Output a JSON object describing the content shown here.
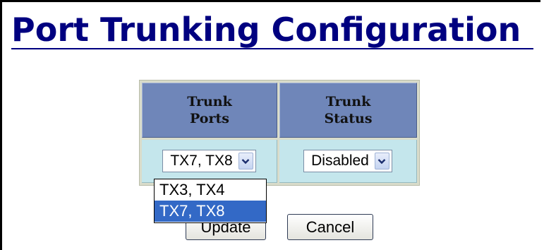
{
  "page": {
    "title": "Port Trunking Configuration"
  },
  "table": {
    "headers": [
      {
        "line1": "Trunk",
        "line2": "Ports"
      },
      {
        "line1": "Trunk",
        "line2": "Status"
      }
    ],
    "row": {
      "trunk_ports_value": "TX7, TX8",
      "trunk_status_value": "Disabled"
    }
  },
  "dropdown": {
    "options": [
      "TX3, TX4",
      "TX7, TX8"
    ],
    "highlighted_index": 1
  },
  "buttons": {
    "update_label": "Update",
    "cancel_label": "Cancel"
  },
  "icons": {
    "dropdown_arrow": "chevron-down-icon"
  },
  "colors": {
    "title": "#000080",
    "header_bg": "#6f86b9",
    "cell_bg": "#c4e6ec",
    "highlight": "#3369c6"
  }
}
